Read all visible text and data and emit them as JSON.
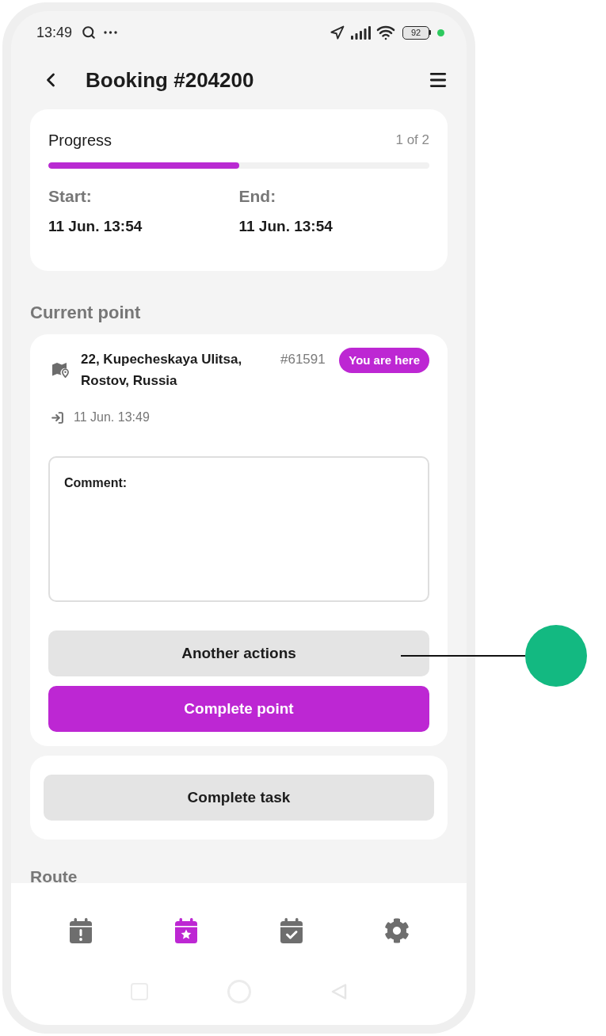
{
  "status_bar": {
    "time": "13:49",
    "battery": "92"
  },
  "header": {
    "title": "Booking #204200"
  },
  "progress": {
    "label": "Progress",
    "count": "1 of 2",
    "level": 0.5,
    "start_label": "Start:",
    "start_value": "11 Jun. 13:54",
    "end_label": "End:",
    "end_value": "11 Jun. 13:54"
  },
  "current_point": {
    "heading": "Current point",
    "address": "22, Kupecheskaya Ulitsa, Rostov, Russia",
    "number": "#61591",
    "badge": "You are here",
    "arrival": "11 Jun. 13:49",
    "comment": {
      "placeholder": "Comment:"
    },
    "buttons": [
      {
        "label": "Another actions",
        "kind": "secondary"
      },
      {
        "label": "Complete point",
        "kind": "primary"
      }
    ]
  },
  "task": {
    "button": "Complete task"
  },
  "route": {
    "heading": "Route"
  },
  "bottom_nav": [
    {
      "kind": "calendar-alert",
      "selected": false
    },
    {
      "kind": "calendar-star",
      "selected": true
    },
    {
      "kind": "calendar-check",
      "selected": false
    },
    {
      "kind": "settings",
      "selected": false
    }
  ],
  "annotation": {
    "kind": "marker"
  }
}
